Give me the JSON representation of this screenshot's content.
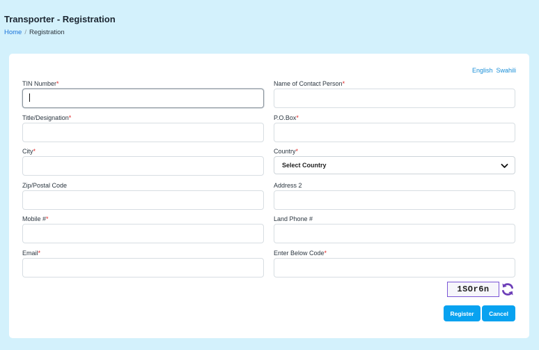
{
  "header": {
    "title": "Transporter - Registration",
    "breadcrumb": {
      "home": "Home",
      "separator": "/",
      "current": "Registration"
    }
  },
  "language": {
    "options": [
      "English",
      "Swahili"
    ]
  },
  "form": {
    "tin_number": {
      "label": "TIN Number",
      "required": "*",
      "value": ""
    },
    "contact_person": {
      "label": "Name of Contact Person",
      "required": "*",
      "value": ""
    },
    "title_designation": {
      "label": "Title/Designation",
      "required": "*",
      "value": ""
    },
    "po_box": {
      "label": "P.O.Box",
      "required": "*",
      "value": ""
    },
    "city": {
      "label": "City",
      "required": "*",
      "value": ""
    },
    "country": {
      "label": "Country",
      "required": "*",
      "selected": "Select Country"
    },
    "zip_code": {
      "label": "Zip/Postal Code",
      "value": ""
    },
    "address2": {
      "label": "Address 2",
      "value": ""
    },
    "mobile": {
      "label": "Mobile #",
      "required": "*",
      "value": ""
    },
    "land_phone": {
      "label": "Land Phone #",
      "value": ""
    },
    "email": {
      "label": "Email",
      "required": "*",
      "value": ""
    },
    "captcha_input": {
      "label": "Enter Below Code",
      "required": "*",
      "value": ""
    }
  },
  "captcha": {
    "code": "1SOr6n",
    "accent": "#7a55d6"
  },
  "buttons": {
    "register": "Register",
    "cancel": "Cancel"
  },
  "colors": {
    "background": "#d3f1fc",
    "primary": "#08a2f0",
    "link": "#1a73d9",
    "required": "#e02424"
  }
}
